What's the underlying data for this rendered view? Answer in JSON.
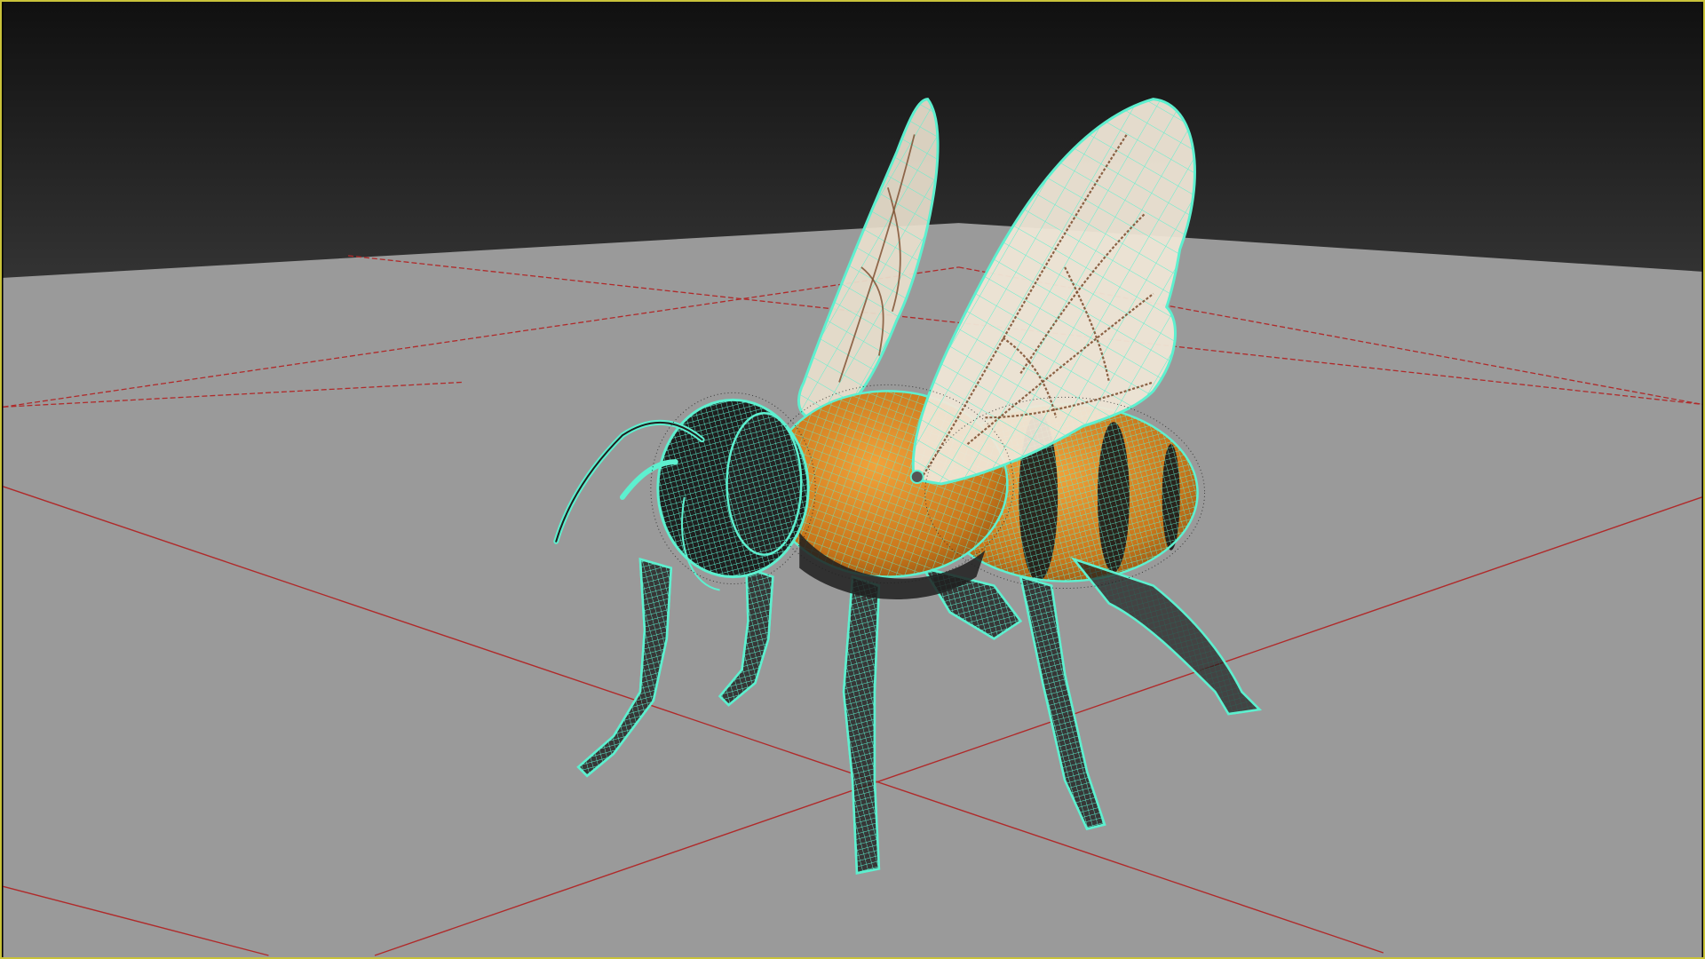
{
  "viewport": {
    "label": "3D viewport",
    "border_color": "#c9c23a",
    "background_top": "#141414",
    "background_horizon": "#333333",
    "ground_color": "#999999",
    "grid_color": "#b02a2a"
  },
  "model": {
    "name": "bee",
    "wireframe_color": "#5df0cf",
    "body_color": "#e08a1c",
    "stripe_color": "#1b1b1b",
    "wing_color": "#efe6d6",
    "wing_vein_color": "#7a4a2a"
  }
}
